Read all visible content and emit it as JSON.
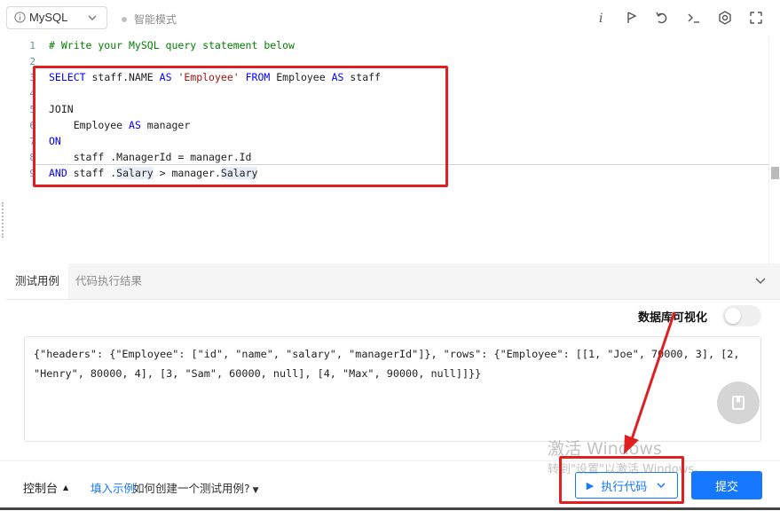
{
  "toolbar": {
    "language": "MySQL",
    "smart_mode": "智能模式"
  },
  "editor": {
    "line_numbers": [
      "1",
      "2",
      "3",
      "4",
      "5",
      "6",
      "7",
      "8",
      "9"
    ],
    "comment": "# Write your MySQL query statement below"
  },
  "panel": {
    "tabs": [
      "测试用例",
      "代码执行结果"
    ],
    "viz_label": "数据库可视化",
    "testcase_text": "{\"headers\": {\"Employee\": [\"id\", \"name\", \"salary\", \"managerId\"]}, \"rows\": {\"Employee\": [[1, \"Joe\", 70000, 3], [2, \"Henry\", 80000, 4], [3, \"Sam\", 60000, null], [4, \"Max\", 90000, null]]}}"
  },
  "footer": {
    "console_label": "控制台",
    "fill_example": "填入示例",
    "how_create": "如何创建一个测试用例?",
    "run_label": "执行代码",
    "submit_label": "提交"
  },
  "watermark": {
    "line1": "激活 Windows",
    "line2": "转到\"设置\"以激活 Windows。"
  },
  "colors": {
    "accent": "#1677ff",
    "annotation_red": "#e02020",
    "keyword": "#0000ff",
    "comment": "#008000",
    "string": "#a31515"
  },
  "icons": [
    "info-icon",
    "chevron-down-icon",
    "italic-i-icon",
    "flag-icon",
    "undo-icon",
    "terminal-icon",
    "settings-icon",
    "fullscreen-icon",
    "collapse-chevron-icon",
    "notebook-icon",
    "play-icon"
  ]
}
